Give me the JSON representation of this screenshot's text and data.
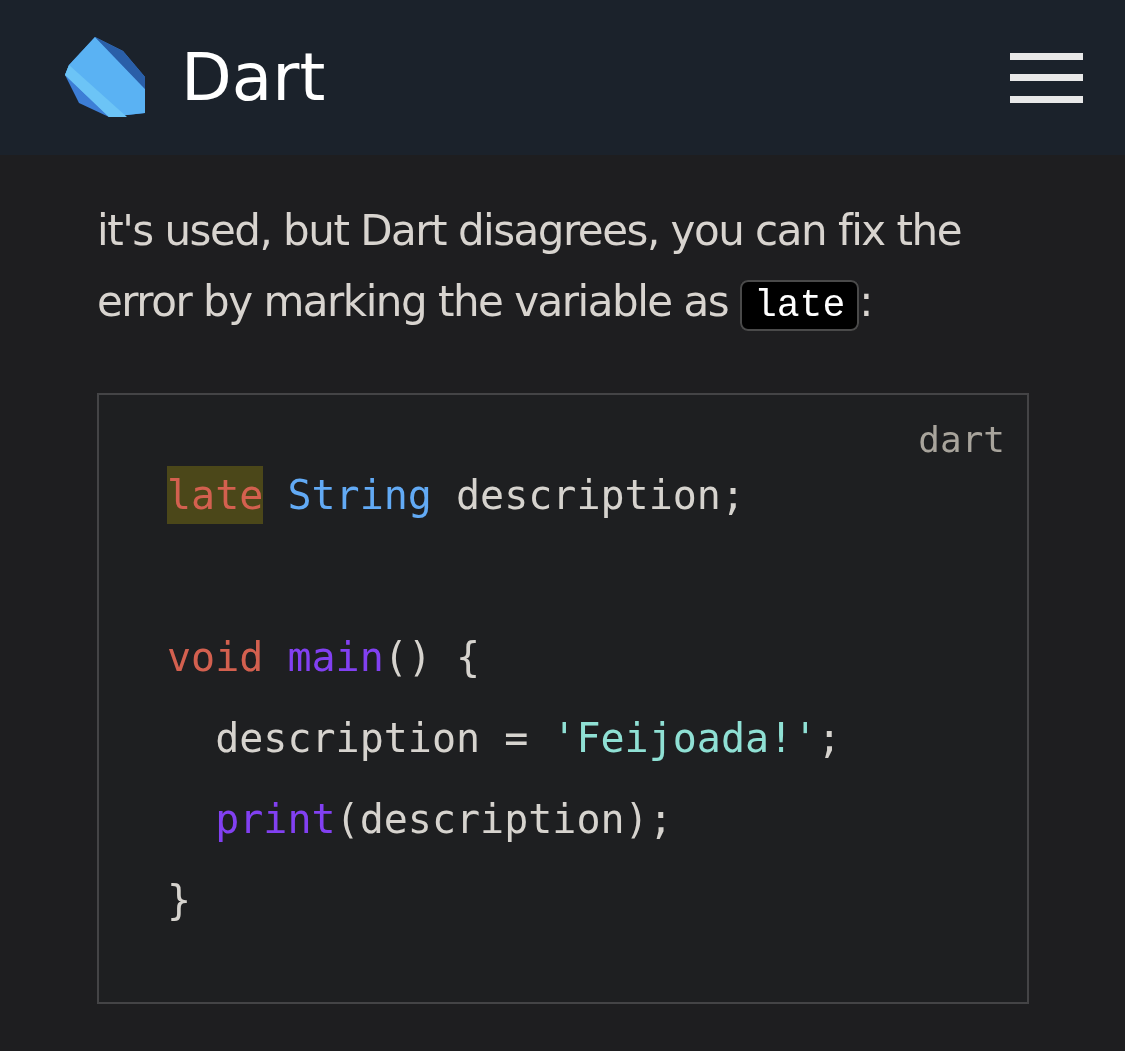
{
  "header": {
    "title": "Dart"
  },
  "paragraph": [
    {
      "kind": "text",
      "text": "it's used, but Dart disagrees, you can fix the error by marking the variable as "
    },
    {
      "kind": "code",
      "text": "late"
    },
    {
      "kind": "text",
      "text": ":"
    }
  ],
  "code_block": {
    "language": "dart",
    "lines": [
      {
        "kind": "code",
        "tokens": [
          {
            "kind": "keyword",
            "text": "late",
            "highlighted": true
          },
          {
            "kind": "type",
            "text": " String",
            "highlighted": false
          },
          {
            "kind": "plain",
            "text": " description;",
            "highlighted": false
          }
        ]
      },
      {
        "kind": "blank"
      },
      {
        "kind": "code",
        "tokens": [
          {
            "kind": "keyword",
            "text": "void",
            "highlighted": false
          },
          {
            "kind": "function",
            "text": " main",
            "highlighted": false
          },
          {
            "kind": "plain",
            "text": "() {",
            "highlighted": false
          }
        ]
      },
      {
        "kind": "code",
        "tokens": [
          {
            "kind": "plain",
            "text": "  description = ",
            "highlighted": false
          },
          {
            "kind": "string",
            "text": "'Feijoada!'",
            "highlighted": false
          },
          {
            "kind": "plain",
            "text": ";",
            "highlighted": false
          }
        ]
      },
      {
        "kind": "code",
        "tokens": [
          {
            "kind": "function",
            "text": "  print",
            "highlighted": false
          },
          {
            "kind": "plain",
            "text": "(description);",
            "highlighted": false
          }
        ]
      },
      {
        "kind": "code",
        "tokens": [
          {
            "kind": "plain",
            "text": "}",
            "highlighted": false
          }
        ]
      }
    ]
  }
}
